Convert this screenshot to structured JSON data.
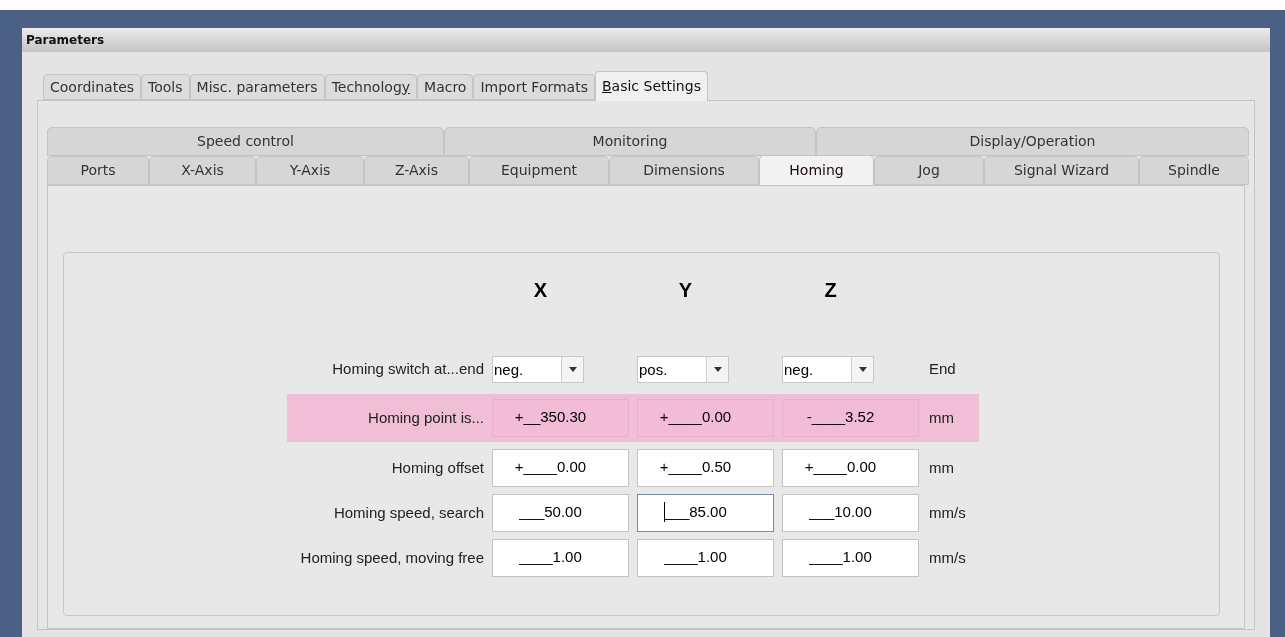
{
  "window": {
    "title": "Parameters"
  },
  "tabs": [
    {
      "text_before": "Coordinates",
      "selected": false
    },
    {
      "text_before": "Tools",
      "selected": false
    },
    {
      "text_before": "Misc. parameters",
      "selected": false
    },
    {
      "text_before": "Technolog",
      "access_key": "y",
      "selected": false
    },
    {
      "text_before": "Macro",
      "selected": false
    },
    {
      "text_before": "Import Formats",
      "selected": false
    },
    {
      "access_key": "B",
      "text_after": "asic Settings",
      "selected": true
    }
  ],
  "subtabs_top": [
    {
      "label": "Speed control",
      "selected": false
    },
    {
      "label": "Monitoring",
      "selected": false
    },
    {
      "label": "Display/Operation",
      "selected": false
    }
  ],
  "subtabs": [
    {
      "label": "Ports",
      "selected": false
    },
    {
      "label": "X-Axis",
      "selected": false
    },
    {
      "label": "Y-Axis",
      "selected": false
    },
    {
      "label": "Z-Axis",
      "selected": false
    },
    {
      "label": "Equipment",
      "selected": false
    },
    {
      "label": "Dimensions",
      "selected": false
    },
    {
      "label": "Homing",
      "selected": true
    },
    {
      "label": "Jog",
      "selected": false
    },
    {
      "label": "Signal Wizard",
      "selected": false
    },
    {
      "label": "Spindle",
      "selected": false
    }
  ],
  "form": {
    "columns": [
      "X",
      "Y",
      "Z"
    ],
    "rows": [
      {
        "label": "Homing switch at...end",
        "highlighted": false,
        "unit": "End",
        "cells": [
          {
            "kind": "dropdown",
            "value": "neg."
          },
          {
            "kind": "dropdown",
            "value": "pos."
          },
          {
            "kind": "dropdown",
            "value": "neg."
          }
        ]
      },
      {
        "label": "Homing point is...",
        "highlighted": true,
        "unit": "mm",
        "cells": [
          {
            "kind": "readonly",
            "value": "+__350.30"
          },
          {
            "kind": "readonly",
            "value": "+____0.00"
          },
          {
            "kind": "readonly",
            "value": "-____3.52"
          }
        ]
      },
      {
        "label": "Homing offset",
        "highlighted": false,
        "unit": "mm",
        "cells": [
          {
            "kind": "input",
            "value": "+____0.00",
            "focused": false
          },
          {
            "kind": "input",
            "value": "+____0.50",
            "focused": false
          },
          {
            "kind": "input",
            "value": "+____0.00",
            "focused": false
          }
        ]
      },
      {
        "label": "Homing speed, search",
        "highlighted": false,
        "unit": "mm/s",
        "cells": [
          {
            "kind": "input",
            "value": "___50.00",
            "focused": false
          },
          {
            "kind": "input",
            "value": "___85.00",
            "focused": true
          },
          {
            "kind": "input",
            "value": "___10.00",
            "focused": false
          }
        ]
      },
      {
        "label": "Homing speed, moving free",
        "highlighted": false,
        "unit": "mm/s",
        "cells": [
          {
            "kind": "input",
            "value": "____1.00",
            "focused": false
          },
          {
            "kind": "input",
            "value": "____1.00",
            "focused": false
          },
          {
            "kind": "input",
            "value": "____1.00",
            "focused": false
          }
        ]
      }
    ]
  }
}
